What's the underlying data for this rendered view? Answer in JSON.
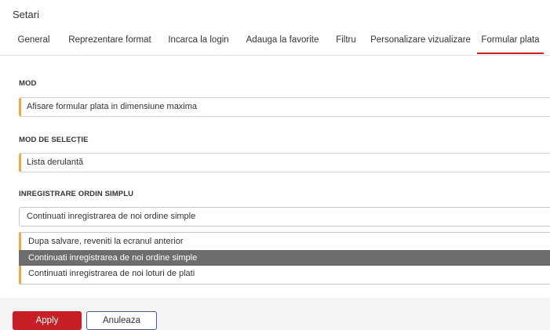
{
  "title": "Setari",
  "tabs": [
    {
      "label": "General"
    },
    {
      "label": "Reprezentare format"
    },
    {
      "label": "Incarca la login"
    },
    {
      "label": "Adauga la favorite"
    },
    {
      "label": "Filtru"
    },
    {
      "label": "Personalizare vizualizare"
    },
    {
      "label": "Formular plata",
      "active": true
    }
  ],
  "mod": {
    "label": "MOD",
    "value": "Afisare formular plata in dimensiune maxima"
  },
  "mod_selectie": {
    "label": "MOD DE SELECȚIE",
    "value": "Lista derulantă"
  },
  "inregistrare": {
    "label": "INREGISTRARE ORDIN SIMPLU",
    "value": "Continuati inregistrarea de noi ordine simple",
    "options": [
      {
        "label": "Dupa salvare, reveniti la ecranul anterior"
      },
      {
        "label": "Continuati inregistrarea de noi ordine simple",
        "selected": true
      },
      {
        "label": "Continuati inregistrarea de noi loturi de plati"
      }
    ]
  },
  "buttons": {
    "apply": "Apply",
    "cancel": "Anuleaza"
  },
  "colors": {
    "accent": "#c62026",
    "field_marker": "#f0a848",
    "selected_option": "#6d6d6d"
  }
}
